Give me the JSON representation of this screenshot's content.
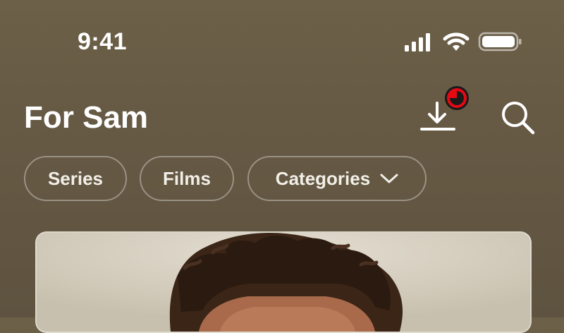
{
  "status_bar": {
    "time": "9:41",
    "icons": [
      "cellular-signal-icon",
      "wifi-icon",
      "battery-icon"
    ]
  },
  "header": {
    "title": "For Sam",
    "download_icon": "download-icon",
    "search_icon": "search-icon",
    "download_badge_color": "#e50914"
  },
  "filters": {
    "series_label": "Series",
    "films_label": "Films",
    "categories_label": "Categories"
  },
  "colors": {
    "background": "#675a45",
    "accent": "#e50914"
  }
}
